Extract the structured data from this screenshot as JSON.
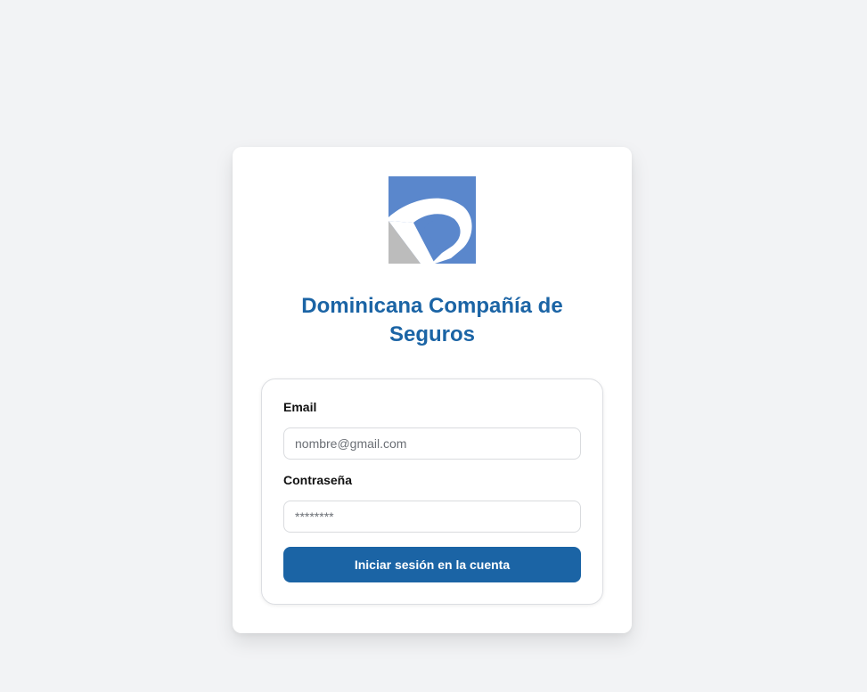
{
  "brand": {
    "logo_icon": "company-logo-icon",
    "title_line1": "Dominicana Compañía de",
    "title_line2": "Seguros",
    "colors": {
      "primary": "#1b64a5",
      "logo_blue": "#5a87cc",
      "logo_gray": "#bcbcbc",
      "background": "#f2f3f5"
    }
  },
  "login_form": {
    "email_label": "Email",
    "email_placeholder": "nombre@gmail.com",
    "email_value": "",
    "password_label": "Contraseña",
    "password_placeholder": "********",
    "password_value": "",
    "submit_label": "Iniciar sesión en la cuenta"
  }
}
